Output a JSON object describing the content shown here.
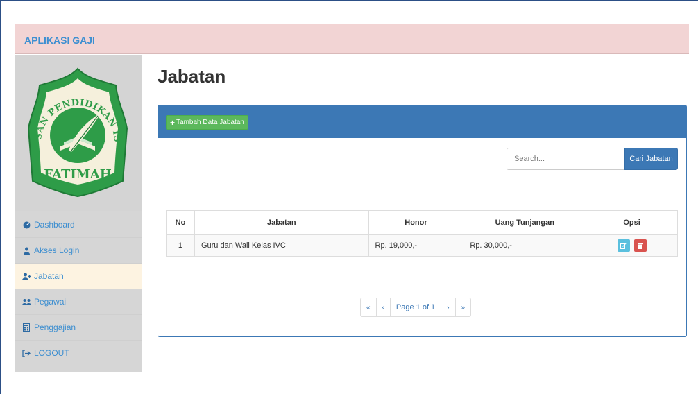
{
  "app": {
    "brand": "APLIKASI GAJI"
  },
  "logo": {
    "top_text": "YAYASAN PENDIDIKAN ISLAM",
    "bottom_text": "FATIMAH"
  },
  "sidebar": {
    "items": [
      {
        "label": "Dashboard",
        "icon": "dashboard-icon",
        "active": false
      },
      {
        "label": "Akses Login",
        "icon": "user-icon",
        "active": false
      },
      {
        "label": "Jabatan",
        "icon": "user-add-icon",
        "active": true
      },
      {
        "label": "Pegawai",
        "icon": "users-icon",
        "active": false
      },
      {
        "label": "Penggajian",
        "icon": "calculator-icon",
        "active": false
      },
      {
        "label": "LOGOUT",
        "icon": "logout-icon",
        "active": false
      }
    ]
  },
  "page": {
    "title": "Jabatan"
  },
  "panel": {
    "add_label": "Tambah Data Jabatan",
    "search_placeholder": "Search...",
    "search_button": "Cari Jabatan"
  },
  "table": {
    "headers": [
      "No",
      "Jabatan",
      "Honor",
      "Uang Tunjangan",
      "Opsi"
    ],
    "rows": [
      {
        "no": "1",
        "jabatan": "Guru dan Wali Kelas IVC",
        "honor": "Rp. 19,000,-",
        "uang_tunjangan": "Rp. 30,000,-"
      }
    ]
  },
  "pagination": {
    "first": "«",
    "prev": "‹",
    "label": "Page 1 of 1",
    "next": "›",
    "last": "»"
  },
  "colors": {
    "topbar": "#f2d4d4",
    "brand": "#3d8fd1",
    "panel_head": "#3c78b5",
    "add_button": "#5cb85c",
    "edit_button": "#5bc0de",
    "delete_button": "#d9534f",
    "logo_green": "#2e9c48"
  }
}
